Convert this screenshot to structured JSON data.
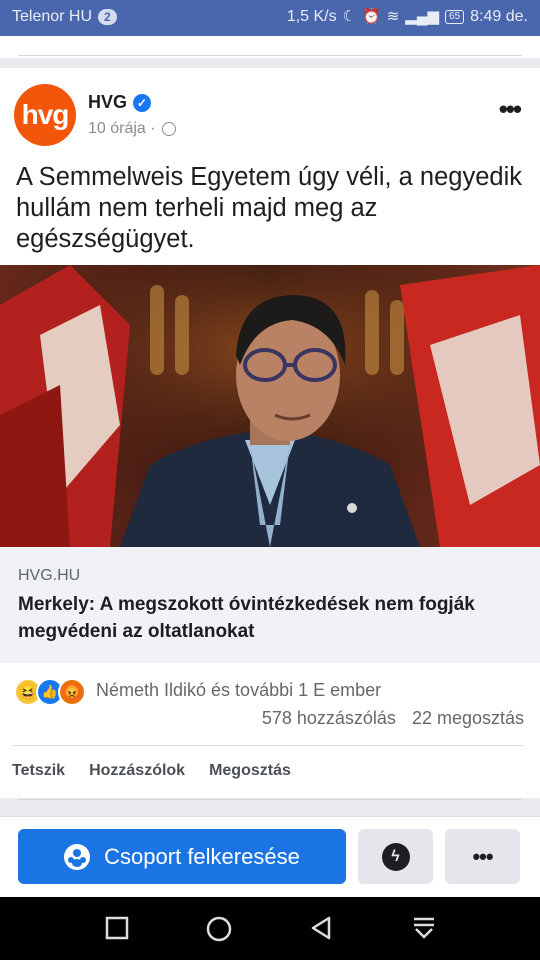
{
  "status_bar": {
    "carrier": "Telenor HU",
    "notification_count": "2",
    "speed": "1,5 K/s",
    "battery": "65",
    "time": "8:49 de."
  },
  "post": {
    "page_name": "HVG",
    "avatar_text": "hvg",
    "timestamp": "10 órája ·",
    "text": "A Semmelweis Egyetem úgy véli, a negyedik hullám nem terheli majd meg az egészségügyet.",
    "link": {
      "domain": "HVG.HU",
      "title": "Merkely: A megszokott óvintézkedések nem fogják megvédeni az oltatlanokat"
    },
    "reactions_text": "Németh Ildikó és további 1 E ember",
    "comments": "578 hozzászólás",
    "shares": "22 megosztás",
    "actions": {
      "like": "Tetszik",
      "comment": "Hozzászólok",
      "share": "Megosztás"
    }
  },
  "bottom_bar": {
    "find_group": "Csoport felkeresése"
  },
  "colors": {
    "status_bar": "#4a66ad",
    "brand_orange": "#f2560b",
    "facebook_blue": "#1b74e4"
  }
}
